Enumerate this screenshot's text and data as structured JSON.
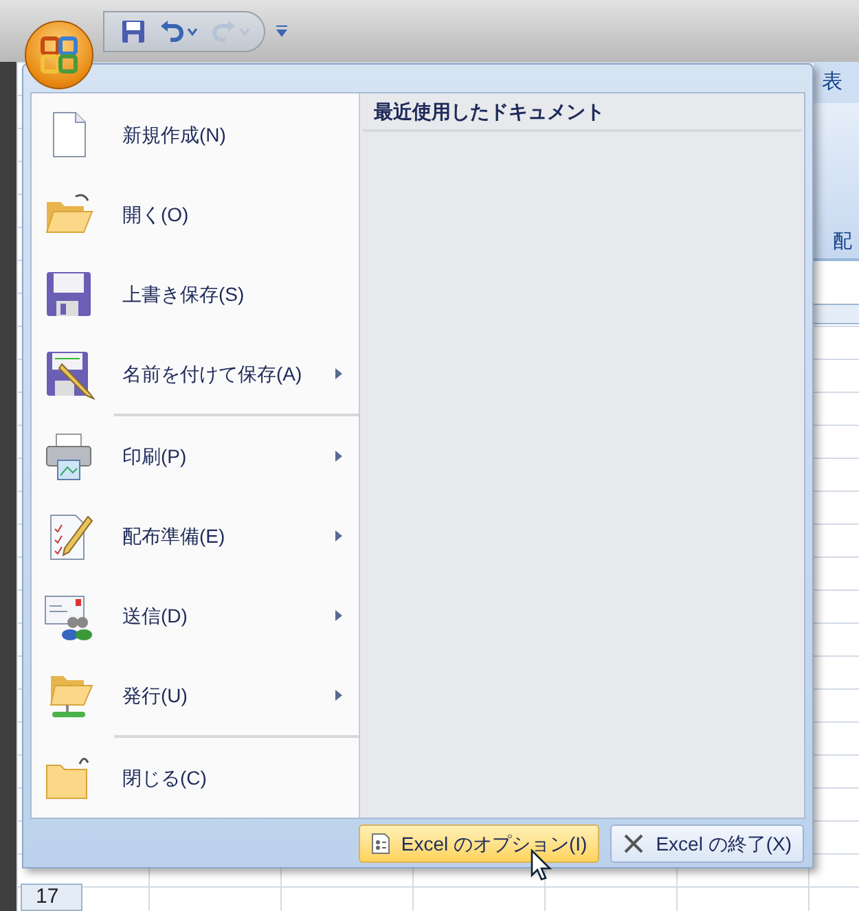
{
  "quick_access": [
    {
      "kind": "save",
      "disabled": false
    },
    {
      "kind": "undo",
      "disabled": false
    },
    {
      "kind": "redo",
      "disabled": true
    }
  ],
  "ribbon": {
    "tab": "表",
    "group": "配"
  },
  "menu": {
    "items": [
      {
        "kind": "new",
        "label": "新規作成(N)",
        "submenu": false
      },
      {
        "kind": "open",
        "label": "開く(O)",
        "submenu": false
      },
      {
        "kind": "save",
        "label": "上書き保存(S)",
        "submenu": false
      },
      {
        "kind": "saveas",
        "label": "名前を付けて保存(A)",
        "submenu": true,
        "separator_after": true
      },
      {
        "kind": "print",
        "label": "印刷(P)",
        "submenu": true
      },
      {
        "kind": "prepare",
        "label": "配布準備(E)",
        "submenu": true
      },
      {
        "kind": "send",
        "label": "送信(D)",
        "submenu": true
      },
      {
        "kind": "publish",
        "label": "発行(U)",
        "submenu": true,
        "separator_after": true
      },
      {
        "kind": "close",
        "label": "閉じる(C)",
        "submenu": false
      }
    ],
    "recent_title": "最近使用したドキュメント",
    "buttons": [
      {
        "kind": "options",
        "label": "Excel のオプション(I)",
        "selected": true
      },
      {
        "kind": "exit",
        "label": "Excel の終了(X)",
        "selected": false
      }
    ]
  },
  "sheet": {
    "row_header": "17"
  }
}
